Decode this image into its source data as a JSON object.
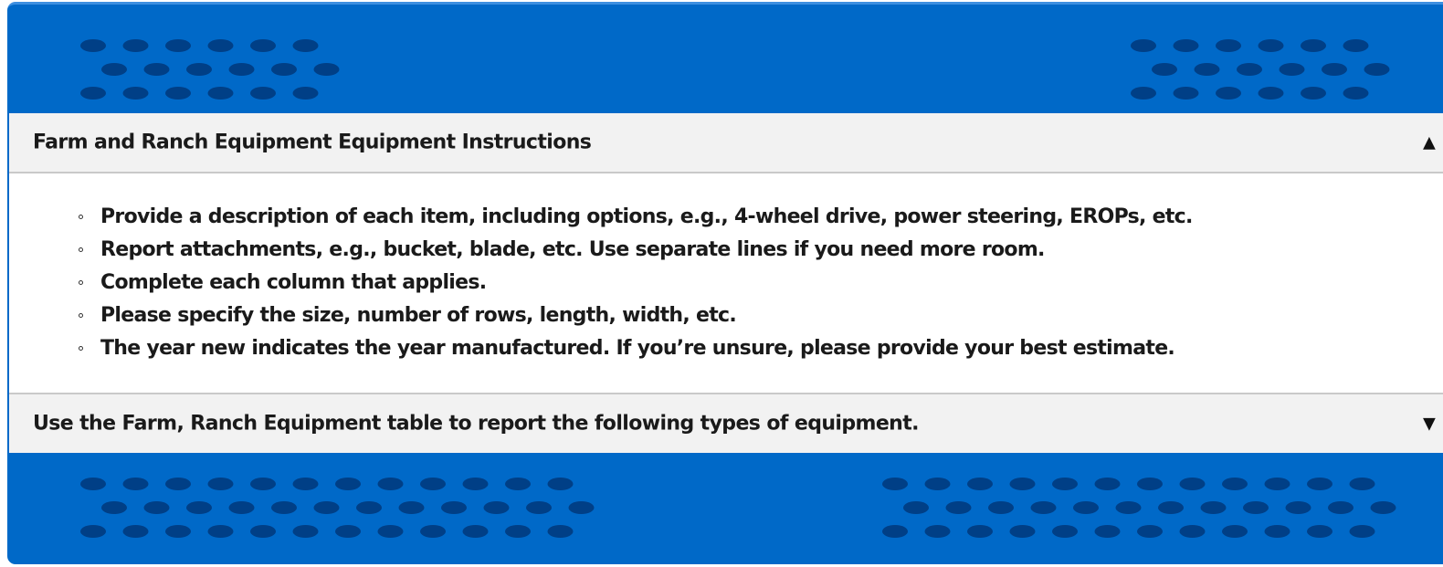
{
  "colors": {
    "band_blue": "#0069c8",
    "hole_dark": "#003f86",
    "header_gray": "#f2f2f2",
    "text": "#1a1a1a"
  },
  "accordion": {
    "sections": [
      {
        "title": "Farm and Ranch Equipment Equipment Instructions",
        "expanded": true,
        "toggle_icon": "caret-up-icon",
        "items": [
          "Provide a description of each item, including options, e.g., 4-wheel drive, power steering, EROPs, etc.",
          "Report attachments, e.g., bucket, blade, etc. Use separate lines if you need more room.",
          "Complete each column that applies.",
          "Please specify the size, number of rows, length, width, etc.",
          "The year new indicates the year manufactured. If you’re unsure, please provide your best estimate."
        ]
      },
      {
        "title": "Use the Farm, Ranch Equipment table to report the following types of equipment.",
        "expanded": false,
        "toggle_icon": "caret-down-icon"
      }
    ]
  }
}
